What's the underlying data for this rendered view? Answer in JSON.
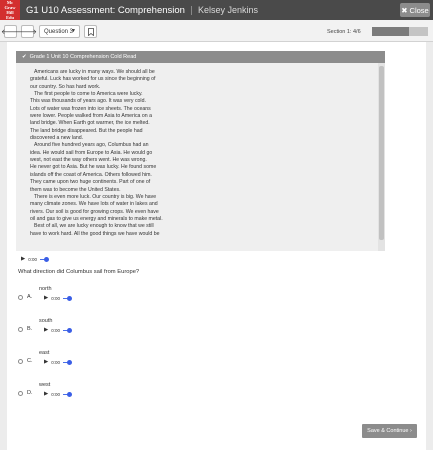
{
  "header": {
    "logo_lines": [
      "Mc",
      "Graw",
      "Hill",
      "Edu"
    ],
    "title": "G1 U10 Assessment: Comprehension",
    "user": "Kelsey Jenkins",
    "close_label": "Close",
    "close_icon": "close-icon"
  },
  "toolbar": {
    "prev_icon": "arrow-left-icon",
    "next_icon": "arrow-right-icon",
    "question_select": "Question 3",
    "bookmark_icon": "bookmark-icon",
    "section_label": "Section 1: 4/6",
    "progress_fraction": 0.667
  },
  "passage": {
    "header": "Grade 1 Unit 10 Comprehension Cold Read",
    "lines": [
      "Americans are lucky in many ways. We should all be",
      "grateful. Luck has worked for us since the beginning of",
      "our country. So has hard work.",
      "The first people to come to America were lucky.",
      "This was thousands of years ago. It was very cold.",
      "Lots of water was frozen into ice sheets. The oceans",
      "were lower. People walked from Asia to America on a",
      "land bridge. When Earth got warmer, the ice melted.",
      "The land bridge disappeared. But the people had",
      "discovered a new land.",
      "Around five hundred years ago, Columbus had an",
      "idea. He would sail from Europe to Asia. He would go",
      "west, not east the way others went. He was wrong.",
      "He never got to Asia. But he was lucky. He found some",
      "islands off the coast of America. Others followed him.",
      "They came upon two huge continents. Part of one of",
      "them was to become the United States.",
      "There is even more luck. Our country is big. We have",
      "many climate zones. We have lots of water in lakes and",
      "rivers. Our soil is good for growing crops. We even have",
      "oil and gas to give us energy and minerals to make metal.",
      "Best of all, we are lucky enough to know that we still",
      "have to work hard. All the good things we have would be"
    ],
    "audio_time": "0:00"
  },
  "question": {
    "text": "What direction did Columbus sail from Europe?",
    "options": [
      {
        "letter": "A.",
        "label": "north",
        "time": "0:00"
      },
      {
        "letter": "B.",
        "label": "south",
        "time": "0:00"
      },
      {
        "letter": "C.",
        "label": "east",
        "time": "0:00"
      },
      {
        "letter": "D.",
        "label": "west",
        "time": "0:00"
      }
    ]
  },
  "footer": {
    "save_label": "Save & Continue ›"
  }
}
